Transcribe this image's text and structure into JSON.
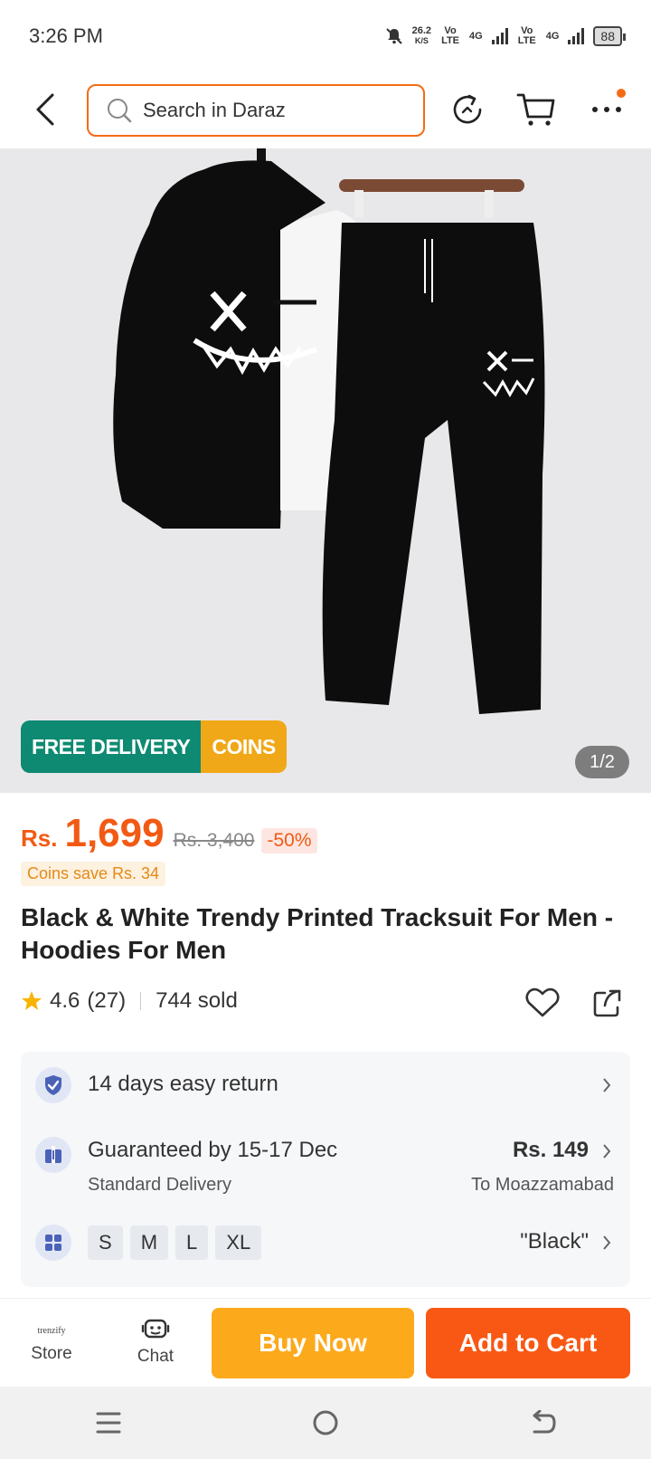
{
  "status": {
    "time": "3:26 PM",
    "net_speed": "26.2",
    "net_unit": "K/S",
    "volte1": "Vo LTE",
    "net_4g1": "4G",
    "volte2": "Vo LTE",
    "net_4g2": "4G",
    "battery": "88"
  },
  "header": {
    "search_placeholder": "Search in Daraz",
    "icons": [
      "back-arrow-icon",
      "search-icon",
      "refresh-icon",
      "cart-icon",
      "more-icon"
    ]
  },
  "gallery": {
    "promo_free": "FREE DELIVERY",
    "promo_coins": "COINS",
    "counter": "1/2"
  },
  "price": {
    "currency": "Rs.",
    "value": "1,699",
    "original": "Rs. 3,400",
    "discount": "-50%",
    "coins_save": "Coins save Rs. 34"
  },
  "product": {
    "title": "Black & White Trendy Printed Tracksuit For Men - Hoodies For Men",
    "rating": "4.6",
    "reviews": "(27)",
    "sold": "744 sold"
  },
  "info": {
    "return_text": "14 days easy return",
    "delivery_text": "Guaranteed by 15-17 Dec",
    "delivery_sub": "Standard Delivery",
    "delivery_price": "Rs. 149",
    "delivery_to": "To Moazzamabad",
    "sizes": [
      "S",
      "M",
      "L",
      "XL"
    ],
    "color": "\"Black\""
  },
  "bottom": {
    "store_logo": "trenzify",
    "store_label": "Store",
    "chat_label": "Chat",
    "buy_now": "Buy Now",
    "add_to_cart": "Add to Cart"
  },
  "colors": {
    "accent": "#f36c15",
    "buy_now": "#fca91c",
    "add_to_cart": "#f85813",
    "free_delivery": "#0f8a72",
    "coins": "#f0a818"
  }
}
